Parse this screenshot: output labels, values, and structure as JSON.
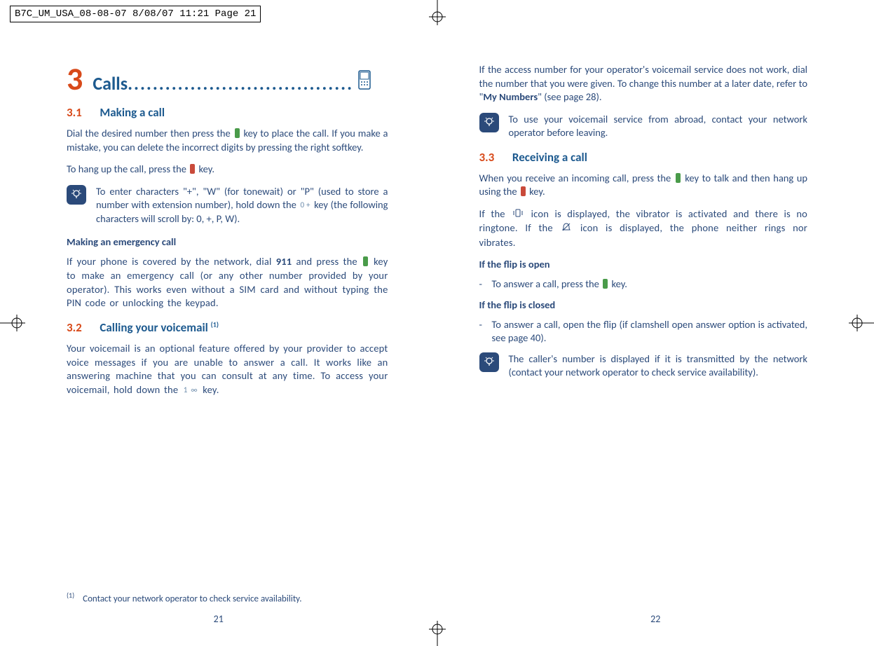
{
  "print_header": "B7C_UM_USA_08-08-07  8/08/07  11:21  Page 21",
  "left": {
    "chapter_num": "3",
    "chapter_title": "Calls",
    "s31_num": "3.1",
    "s31_title": "Making a call",
    "s31_p1a": "Dial the desired number then press the ",
    "s31_p1b": " key to place the call. If you make a mistake, you can delete the incorrect digits by pressing the right softkey.",
    "s31_p2a": "To hang up the call, press the ",
    "s31_p2b": " key.",
    "note1a": "To enter characters \"+\", \"W\" (for tonewait) or \"P\" (used to store a number with extension number), hold down the ",
    "note1_key": "0 +",
    "note1b": " key (the following characters will scroll by: 0, +, P, W).",
    "emerg_head": "Making an emergency call",
    "emerg_p_a": "If your phone is covered by the network, dial ",
    "emerg_num": "911",
    "emerg_p_b": " and press the ",
    "emerg_p_c": " key to make an emergency call (or any other number provided by your operator). This works even without a SIM card and without typing the PIN code or unlocking the keypad.",
    "s32_num": "3.2",
    "s32_title_a": "Calling your voicemail ",
    "s32_title_sup": "(1)",
    "s32_p_a": "Your voicemail is an optional feature offered by your provider to accept voice messages if you are unable to answer a call. It works like an answering machine that you can consult at any time. To access your voicemail, hold down the ",
    "s32_key": "1 ∞",
    "s32_p_b": " key.",
    "footnote_sup": "(1)",
    "footnote": "Contact your network operator to check service availability.",
    "pagenum": "21"
  },
  "right": {
    "top_p_a": "If the access number for your operator's voicemail service does not work, dial the number that you were given. To change this number at a later date, refer to \"",
    "top_p_bold": "My Numbers",
    "top_p_b": "\" (see page 28).",
    "note2": "To use your voicemail service from abroad, contact your network operator before leaving.",
    "s33_num": "3.3",
    "s33_title": "Receiving a call",
    "s33_p1a": "When you receive an incoming call, press the ",
    "s33_p1b": " key to talk and then hang up using the ",
    "s33_p1c": " key.",
    "s33_p2a": "If the ",
    "s33_p2b": " icon is displayed, the vibrator is activated and there is no ringtone. If the ",
    "s33_p2c": " icon is displayed, the phone neither rings nor vibrates.",
    "flip_open_head": "If the flip is open",
    "flip_open_item_a": "To answer a call, press the ",
    "flip_open_item_b": " key.",
    "flip_closed_head": "If the flip is closed",
    "flip_closed_item": "To answer a call, open the flip (if clamshell open answer option is activated, see page 40).",
    "note3": "The caller's number is displayed if it is transmitted by the network (contact your network operator to check service availability).",
    "pagenum": "22"
  }
}
